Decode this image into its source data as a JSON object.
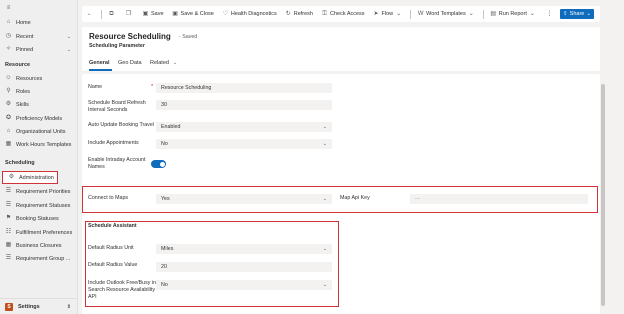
{
  "sidebar": {
    "top_items": [
      {
        "label": "Home",
        "icon": "home-icon"
      },
      {
        "label": "Recent",
        "icon": "clock-icon"
      },
      {
        "label": "Pinned",
        "icon": "pin-icon"
      }
    ],
    "resource_header": "Resource",
    "resource_items": [
      {
        "label": "Resources"
      },
      {
        "label": "Roles"
      },
      {
        "label": "Skills"
      },
      {
        "label": "Proficiency Models"
      },
      {
        "label": "Organizational Units"
      },
      {
        "label": "Work Hours Templates"
      }
    ],
    "scheduling_header": "Scheduling",
    "scheduling_items": [
      {
        "label": "Administration"
      },
      {
        "label": "Requirement Priorities"
      },
      {
        "label": "Requirement Statuses"
      },
      {
        "label": "Booking Statuses"
      },
      {
        "label": "Fulfillment Preferences"
      },
      {
        "label": "Business Closures"
      },
      {
        "label": "Requirement Group ..."
      }
    ],
    "settings_badge": "S",
    "settings_label": "Settings"
  },
  "toolbar": {
    "save": "Save",
    "save_close": "Save & Close",
    "health": "Health Diagnostics",
    "refresh": "Refresh",
    "check_access": "Check Access",
    "flow": "Flow",
    "word_templates": "Word Templates",
    "run_report": "Run Report",
    "share": "Share"
  },
  "header": {
    "title": "Resource Scheduling",
    "saved_status": "- Saved",
    "subtitle": "Scheduling Parameter",
    "tabs": [
      "General",
      "Geo Data",
      "Related"
    ]
  },
  "form": {
    "name_label": "Name",
    "name_value": "Resource Scheduling",
    "refresh_label": "Schedule Board Refresh Interval Seconds",
    "refresh_value": "30",
    "travel_label": "Auto Update Booking Travel",
    "travel_value": "Enabled",
    "appointments_label": "Include Appointments",
    "appointments_value": "No",
    "intraday_label": "Enable Intraday Account Names",
    "connect_maps_label": "Connect to Maps",
    "connect_maps_value": "Yes",
    "map_key_label": "Map Api Key",
    "map_key_value": "---",
    "assistant_header": "Schedule Assistant",
    "radius_unit_label": "Default Radius Unit",
    "radius_unit_value": "Miles",
    "radius_value_label": "Default Radius Value",
    "radius_value_value": "20",
    "outlook_label": "Include Outlook Free/Busy in Search Resource Availability API",
    "outlook_value": "No"
  },
  "colors": {
    "accent": "#0f6cbd",
    "highlight": "#d13438"
  }
}
